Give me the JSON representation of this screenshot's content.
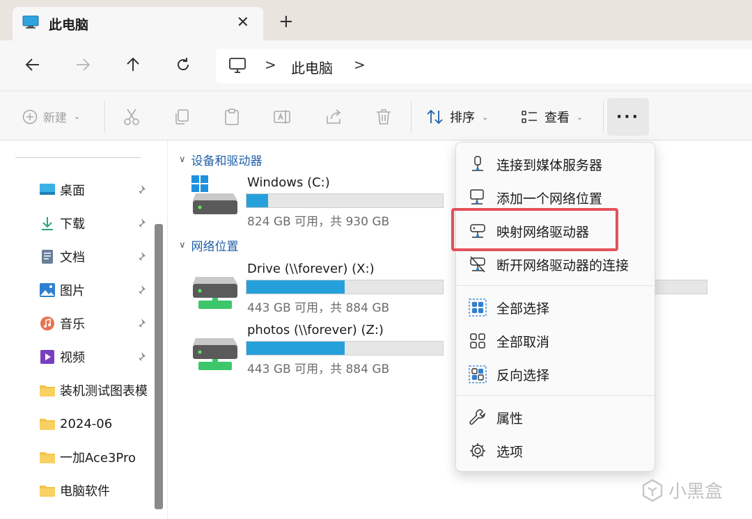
{
  "tab": {
    "title": "此电脑",
    "close_icon": "close-icon",
    "new_tab_icon": "plus-icon"
  },
  "nav": {
    "back": "back-arrow-icon",
    "forward": "forward-arrow-icon",
    "up": "up-arrow-icon",
    "refresh": "refresh-icon"
  },
  "address": {
    "sep1": ">",
    "location": "此电脑",
    "sep2": ">"
  },
  "toolbar": {
    "new_label": "新建",
    "sort_label": "排序",
    "view_label": "查看",
    "more_label": "···"
  },
  "sidebar": {
    "items": [
      {
        "label": "桌面",
        "icon": "desktop-icon",
        "pinned": true
      },
      {
        "label": "下载",
        "icon": "download-icon",
        "pinned": true
      },
      {
        "label": "文档",
        "icon": "document-icon",
        "pinned": true
      },
      {
        "label": "图片",
        "icon": "pictures-icon",
        "pinned": true
      },
      {
        "label": "音乐",
        "icon": "music-icon",
        "pinned": true
      },
      {
        "label": "视频",
        "icon": "video-icon",
        "pinned": true
      },
      {
        "label": "装机测试图表模",
        "icon": "folder-icon",
        "pinned": false
      },
      {
        "label": "2024-06",
        "icon": "folder-icon",
        "pinned": false
      },
      {
        "label": "一加Ace3Pro",
        "icon": "folder-icon",
        "pinned": false
      },
      {
        "label": "电脑软件",
        "icon": "folder-icon",
        "pinned": false
      }
    ]
  },
  "main": {
    "groups": [
      {
        "title": "设备和驱动器"
      },
      {
        "title": "网络位置"
      }
    ],
    "drives": [
      {
        "name": "Windows (C:)",
        "info": "824 GB 可用，共 930 GB",
        "used_fraction": 0.11,
        "icon": "windows-drive-icon"
      },
      {
        "name": "Drive (\\\\forever) (X:)",
        "info": "443 GB 可用，共 884 GB",
        "used_fraction": 0.5,
        "icon": "network-drive-icon"
      },
      {
        "name": "photos (\\\\forever) (Z:)",
        "info": "443 GB 可用，共 884 GB",
        "used_fraction": 0.5,
        "icon": "network-drive-icon"
      }
    ]
  },
  "menu": {
    "items": [
      {
        "label": "连接到媒体服务器",
        "icon": "media-server-icon"
      },
      {
        "label": "添加一个网络位置",
        "icon": "network-location-icon"
      },
      {
        "label": "映射网络驱动器",
        "icon": "map-network-drive-icon",
        "highlighted": true
      },
      {
        "label": "断开网络驱动器的连接",
        "icon": "disconnect-network-drive-icon"
      },
      {
        "label": "全部选择",
        "icon": "select-all-icon"
      },
      {
        "label": "全部取消",
        "icon": "select-none-icon"
      },
      {
        "label": "反向选择",
        "icon": "invert-selection-icon"
      },
      {
        "label": "属性",
        "icon": "wrench-icon"
      },
      {
        "label": "选项",
        "icon": "gear-icon"
      }
    ]
  },
  "watermark": {
    "text": "小黑盒"
  },
  "colors": {
    "accent": "#26a0da",
    "highlight": "#e4505a",
    "group_header": "#1f5fa8"
  }
}
